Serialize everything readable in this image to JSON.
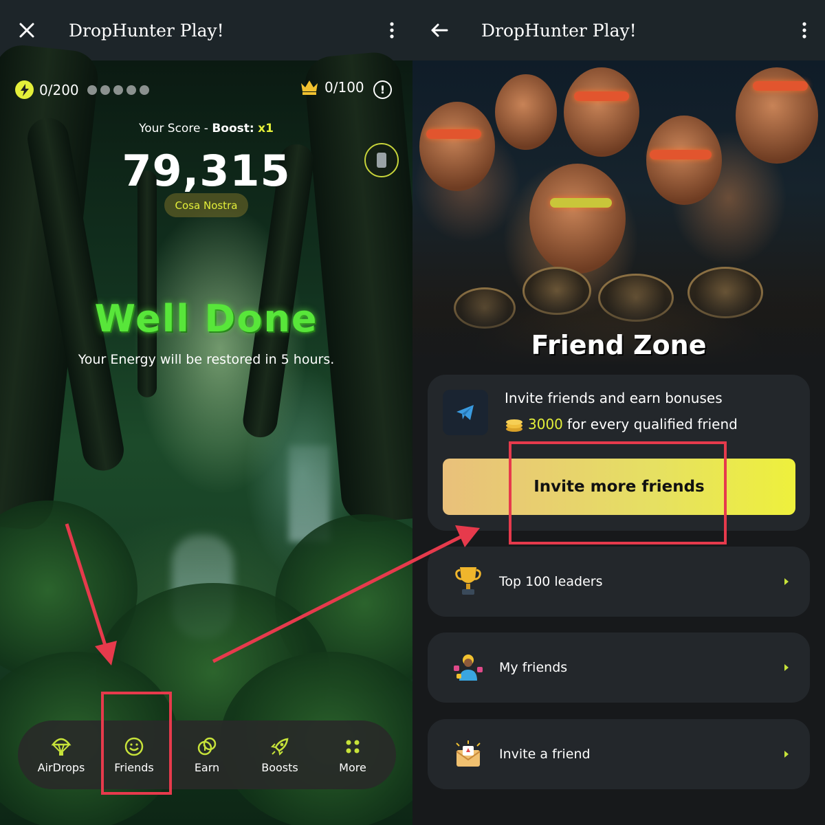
{
  "left": {
    "topbar": {
      "title": "DropHunter Play!",
      "nav_icon": "close-icon"
    },
    "hud": {
      "energy": "0/200",
      "crown": "0/100"
    },
    "score_label": {
      "prefix": "Your Score - ",
      "boost_label": "Boost:",
      "boost_value": "x1"
    },
    "score": "79,315",
    "clan": "Cosa Nostra",
    "headline": "Well Done",
    "message": "Your Energy will be restored in 5 hours.",
    "nav": [
      {
        "label": "AirDrops",
        "icon": "parachute-icon"
      },
      {
        "label": "Friends",
        "icon": "smiley-icon"
      },
      {
        "label": "Earn",
        "icon": "coins-icon"
      },
      {
        "label": "Boosts",
        "icon": "rocket-icon"
      },
      {
        "label": "More",
        "icon": "grid-dots-icon"
      }
    ]
  },
  "right": {
    "topbar": {
      "title": "DropHunter Play!",
      "nav_icon": "back-arrow-icon"
    },
    "hero_title": "Friend Zone",
    "invite": {
      "title": "Invite friends and earn bonuses",
      "amount": "3000",
      "amount_suffix": "for every qualified friend",
      "button": "Invite more friends"
    },
    "rows": [
      {
        "label": "Top 100 leaders",
        "icon": "trophy-icon"
      },
      {
        "label": "My friends",
        "icon": "friends-icon"
      },
      {
        "label": "Invite a friend",
        "icon": "envelope-icon"
      }
    ]
  },
  "colors": {
    "accent": "#e4ef3a",
    "annotation": "#e63a4c",
    "card": "#23272b",
    "topbar": "#1d2529"
  }
}
